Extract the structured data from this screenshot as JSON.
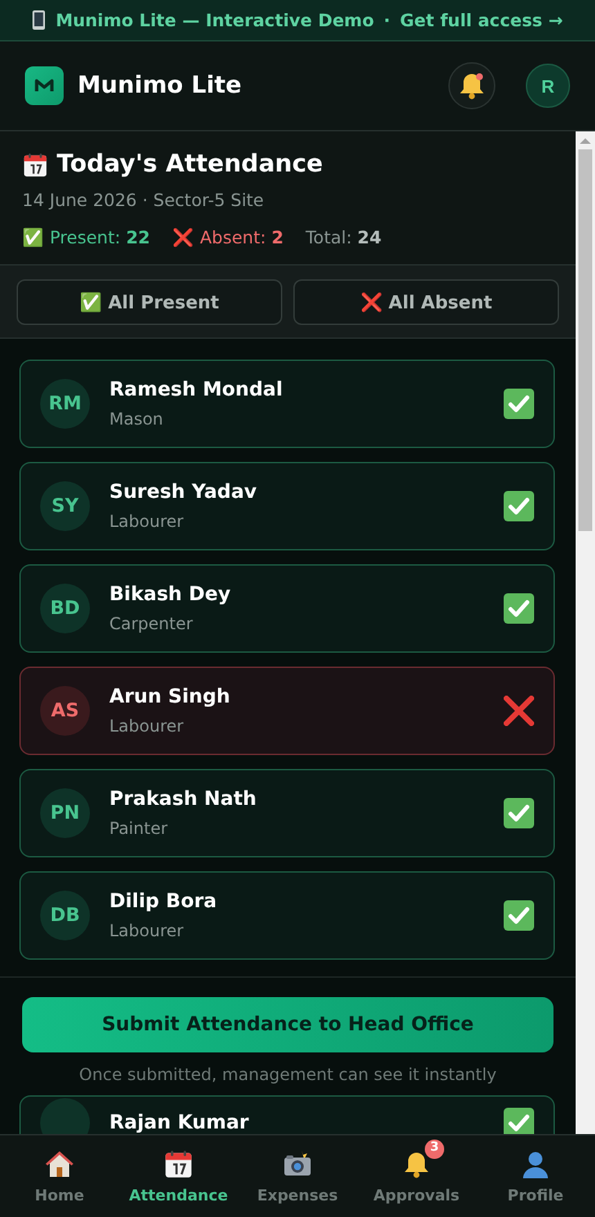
{
  "banner": {
    "text": "Munimo Lite — Interactive Demo",
    "separator": "·",
    "link": "Get full access →"
  },
  "header": {
    "title": "Munimo Lite",
    "notification_dot": true,
    "avatar": "R"
  },
  "attendance": {
    "title": "Today's Attendance",
    "subtitle": "14 June 2026 · Sector-5 Site",
    "stats": [
      {
        "kind": "present",
        "icon": "✅",
        "label": "Present:",
        "value": "22"
      },
      {
        "kind": "absent",
        "icon": "❌",
        "label": "Absent:",
        "value": "2"
      },
      {
        "kind": "total",
        "label": "Total:",
        "value": "24"
      }
    ]
  },
  "bulk_buttons": [
    {
      "label": "✅ All Present"
    },
    {
      "label": "❌ All Absent"
    }
  ],
  "workers": [
    {
      "initials": "RM",
      "name": "Ramesh Mondal",
      "role": "Mason",
      "present": true
    },
    {
      "initials": "SY",
      "name": "Suresh Yadav",
      "role": "Labourer",
      "present": true
    },
    {
      "initials": "BD",
      "name": "Bikash Dey",
      "role": "Carpenter",
      "present": true
    },
    {
      "initials": "AS",
      "name": "Arun Singh",
      "role": "Labourer",
      "present": false
    },
    {
      "initials": "PN",
      "name": "Prakash Nath",
      "role": "Painter",
      "present": true
    },
    {
      "initials": "DB",
      "name": "Dilip Bora",
      "role": "Labourer",
      "present": true
    }
  ],
  "submit": {
    "label": "Submit Attendance to Head Office",
    "note": "Once submitted, management can see it instantly"
  },
  "next_worker": {
    "name": "Rajan Kumar",
    "present": true
  },
  "nav": [
    {
      "label": "Home",
      "selected": false
    },
    {
      "label": "Attendance",
      "selected": true
    },
    {
      "label": "Expenses",
      "selected": false
    },
    {
      "label": "Approvals",
      "selected": false,
      "badge": "3"
    },
    {
      "label": "Profile",
      "selected": false
    }
  ]
}
